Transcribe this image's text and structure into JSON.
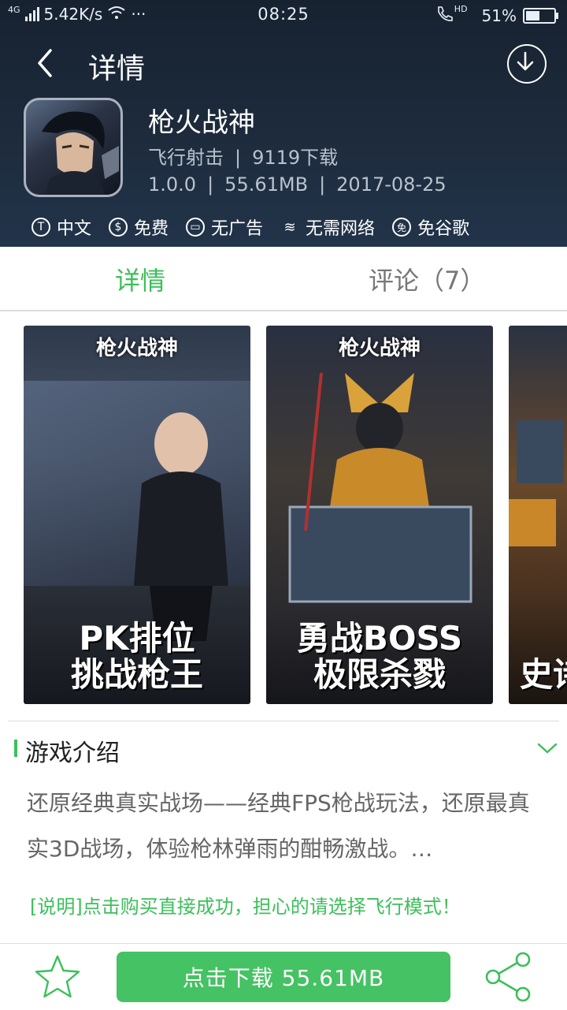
{
  "status_bar": {
    "network": "4G",
    "speed": "5.42K/s",
    "dots": "···",
    "time": "08:25",
    "hd": "HD",
    "battery": "51%",
    "battery_level": 0.51
  },
  "topbar": {
    "title": "详情"
  },
  "app": {
    "name": "枪火战神",
    "category": "飞行射击",
    "downloads": "9119下载",
    "version": "1.0.0",
    "size": "55.61MB",
    "date": "2017-08-25",
    "separator": "|"
  },
  "tags": [
    {
      "icon": "T",
      "label": "中文"
    },
    {
      "icon": "$",
      "label": "免费"
    },
    {
      "icon": "▭",
      "label": "无广告"
    },
    {
      "icon": "≋",
      "label": "无需网络"
    },
    {
      "icon": "免",
      "label": "免谷歌"
    }
  ],
  "tabs": {
    "detail": "详情",
    "comments": "评论（7）"
  },
  "screenshots": [
    {
      "title": "枪火战神",
      "caption_line1": "PK排位",
      "caption_line2": "挑战枪王",
      "accent": "#8a5a3a"
    },
    {
      "title": "枪火战神",
      "caption_line1": "勇战BOSS",
      "caption_line2": "极限杀戮",
      "accent": "#c98a2a"
    },
    {
      "title": "",
      "caption_line1": "史诗",
      "caption_line2": "",
      "accent": "#b8712a"
    }
  ],
  "section": {
    "title": "游戏介绍",
    "intro": "还原经典真实战场——经典FPS枪战玩法，还原最真实3D战场，体验枪林弹雨的酣畅激战。…",
    "notice": "[说明]点击购买直接成功，担心的请选择飞行模式！"
  },
  "bottom": {
    "download_label": "点击下载 55.61MB"
  },
  "colors": {
    "accent_green": "#3cbf5a",
    "header_dark": "#1d2b3c"
  }
}
